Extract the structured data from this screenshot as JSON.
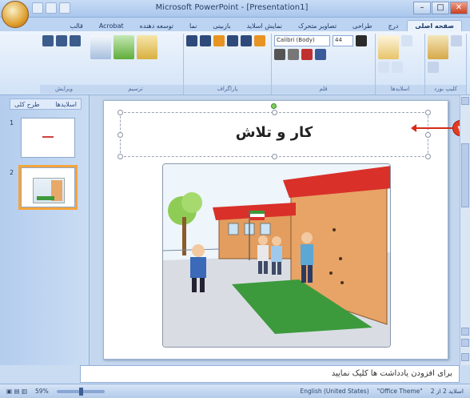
{
  "window": {
    "title": "Microsoft PowerPoint - [Presentation1]",
    "minimize_label": "–",
    "maximize_label": "□",
    "close_label": "✕"
  },
  "ribbon": {
    "tabs": [
      "صفحه اصلی",
      "درج",
      "طراحی",
      "تصاویر متحرک",
      "نمایش اسلاید",
      "بازبینی",
      "نما",
      "توسعه دهنده",
      "Acrobat",
      "قالب"
    ],
    "active_tab": "صفحه اصلی",
    "groups": [
      "کلیپ بورد",
      "اسلایدها",
      "قلم",
      "پاراگراف",
      "ترسیم",
      "ویرایش"
    ],
    "font_name": "Calibri (Body)",
    "font_size": "44"
  },
  "slides_panel": {
    "tab_slides": "اسلایدها",
    "tab_outline": "طرح کلی",
    "thumb1_number": "1",
    "thumb2_number": "2"
  },
  "slide": {
    "title": "کار و تلاش"
  },
  "callout": {
    "number": "۷"
  },
  "notes": {
    "placeholder": "برای افزودن یادداشت ها کلیک نمایید"
  },
  "statusbar": {
    "slide_info": "اسلاید 2 از 2",
    "theme": "\"Office Theme\"",
    "language": "English (United States)",
    "zoom": "59%"
  },
  "colors": {
    "accent_orange": "#f5a43a",
    "callout_red": "#e23b24",
    "ribbon_blue": "#d2e3f7"
  }
}
